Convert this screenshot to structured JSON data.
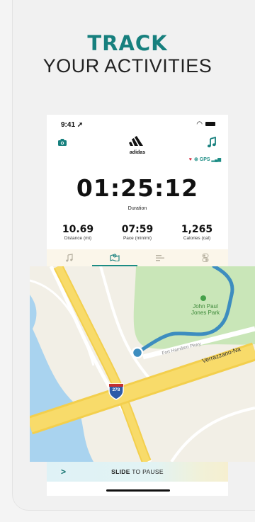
{
  "headline": {
    "line1": "TRACK",
    "line2": "YOUR ACTIVITIES"
  },
  "status_bar": {
    "time": "9:41"
  },
  "app": {
    "brand_name": "adidas",
    "gps_label": "GPS",
    "duration": {
      "value": "01:25:12",
      "label": "Duration"
    },
    "stats": [
      {
        "value": "10.69",
        "label": "Distance (mi)"
      },
      {
        "value": "07:59",
        "label": "Pace (min/mi)"
      },
      {
        "value": "1,265",
        "label": "Calories (cal)"
      }
    ],
    "tabs": [
      {
        "icon": "music-icon"
      },
      {
        "icon": "map-icon"
      },
      {
        "icon": "stats-icon"
      },
      {
        "icon": "toggle-icon"
      }
    ]
  },
  "map": {
    "park_name": "John Paul\nJones Park",
    "street_small": "Fort Hamilton Pkwy",
    "highway_name": "Verrazzano-Na",
    "highway_shield": "278"
  },
  "slide": {
    "arrow": ">",
    "label_bold": "SLIDE",
    "label_rest": " TO PAUSE"
  },
  "colors": {
    "accent": "#17807e",
    "route": "#3d8dbf",
    "park": "#c9e6b8",
    "highway": "#f6d55c"
  }
}
